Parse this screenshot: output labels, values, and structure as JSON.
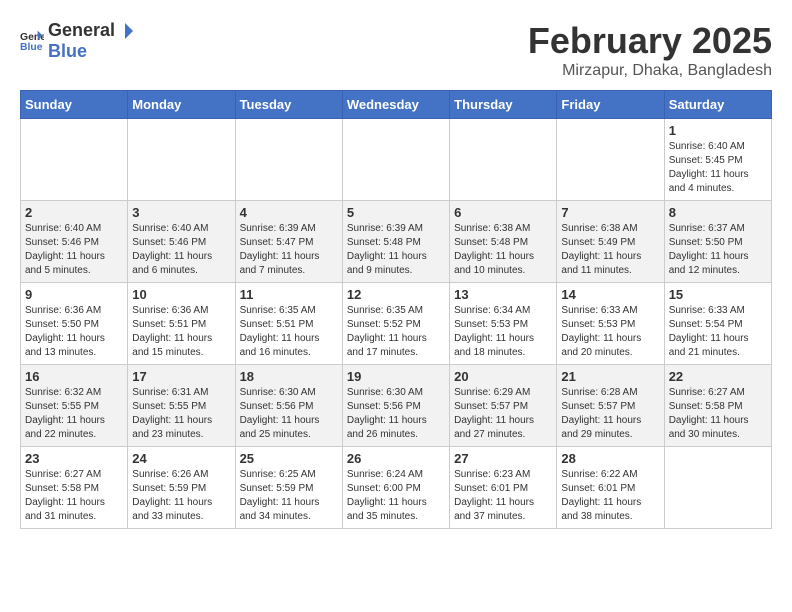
{
  "logo": {
    "general": "General",
    "blue": "Blue"
  },
  "title": "February 2025",
  "subtitle": "Mirzapur, Dhaka, Bangladesh",
  "weekdays": [
    "Sunday",
    "Monday",
    "Tuesday",
    "Wednesday",
    "Thursday",
    "Friday",
    "Saturday"
  ],
  "weeks": [
    [
      {
        "day": "",
        "info": ""
      },
      {
        "day": "",
        "info": ""
      },
      {
        "day": "",
        "info": ""
      },
      {
        "day": "",
        "info": ""
      },
      {
        "day": "",
        "info": ""
      },
      {
        "day": "",
        "info": ""
      },
      {
        "day": "1",
        "info": "Sunrise: 6:40 AM\nSunset: 5:45 PM\nDaylight: 11 hours and 4 minutes."
      }
    ],
    [
      {
        "day": "2",
        "info": "Sunrise: 6:40 AM\nSunset: 5:46 PM\nDaylight: 11 hours and 5 minutes."
      },
      {
        "day": "3",
        "info": "Sunrise: 6:40 AM\nSunset: 5:46 PM\nDaylight: 11 hours and 6 minutes."
      },
      {
        "day": "4",
        "info": "Sunrise: 6:39 AM\nSunset: 5:47 PM\nDaylight: 11 hours and 7 minutes."
      },
      {
        "day": "5",
        "info": "Sunrise: 6:39 AM\nSunset: 5:48 PM\nDaylight: 11 hours and 9 minutes."
      },
      {
        "day": "6",
        "info": "Sunrise: 6:38 AM\nSunset: 5:48 PM\nDaylight: 11 hours and 10 minutes."
      },
      {
        "day": "7",
        "info": "Sunrise: 6:38 AM\nSunset: 5:49 PM\nDaylight: 11 hours and 11 minutes."
      },
      {
        "day": "8",
        "info": "Sunrise: 6:37 AM\nSunset: 5:50 PM\nDaylight: 11 hours and 12 minutes."
      }
    ],
    [
      {
        "day": "9",
        "info": "Sunrise: 6:36 AM\nSunset: 5:50 PM\nDaylight: 11 hours and 13 minutes."
      },
      {
        "day": "10",
        "info": "Sunrise: 6:36 AM\nSunset: 5:51 PM\nDaylight: 11 hours and 15 minutes."
      },
      {
        "day": "11",
        "info": "Sunrise: 6:35 AM\nSunset: 5:51 PM\nDaylight: 11 hours and 16 minutes."
      },
      {
        "day": "12",
        "info": "Sunrise: 6:35 AM\nSunset: 5:52 PM\nDaylight: 11 hours and 17 minutes."
      },
      {
        "day": "13",
        "info": "Sunrise: 6:34 AM\nSunset: 5:53 PM\nDaylight: 11 hours and 18 minutes."
      },
      {
        "day": "14",
        "info": "Sunrise: 6:33 AM\nSunset: 5:53 PM\nDaylight: 11 hours and 20 minutes."
      },
      {
        "day": "15",
        "info": "Sunrise: 6:33 AM\nSunset: 5:54 PM\nDaylight: 11 hours and 21 minutes."
      }
    ],
    [
      {
        "day": "16",
        "info": "Sunrise: 6:32 AM\nSunset: 5:55 PM\nDaylight: 11 hours and 22 minutes."
      },
      {
        "day": "17",
        "info": "Sunrise: 6:31 AM\nSunset: 5:55 PM\nDaylight: 11 hours and 23 minutes."
      },
      {
        "day": "18",
        "info": "Sunrise: 6:30 AM\nSunset: 5:56 PM\nDaylight: 11 hours and 25 minutes."
      },
      {
        "day": "19",
        "info": "Sunrise: 6:30 AM\nSunset: 5:56 PM\nDaylight: 11 hours and 26 minutes."
      },
      {
        "day": "20",
        "info": "Sunrise: 6:29 AM\nSunset: 5:57 PM\nDaylight: 11 hours and 27 minutes."
      },
      {
        "day": "21",
        "info": "Sunrise: 6:28 AM\nSunset: 5:57 PM\nDaylight: 11 hours and 29 minutes."
      },
      {
        "day": "22",
        "info": "Sunrise: 6:27 AM\nSunset: 5:58 PM\nDaylight: 11 hours and 30 minutes."
      }
    ],
    [
      {
        "day": "23",
        "info": "Sunrise: 6:27 AM\nSunset: 5:58 PM\nDaylight: 11 hours and 31 minutes."
      },
      {
        "day": "24",
        "info": "Sunrise: 6:26 AM\nSunset: 5:59 PM\nDaylight: 11 hours and 33 minutes."
      },
      {
        "day": "25",
        "info": "Sunrise: 6:25 AM\nSunset: 5:59 PM\nDaylight: 11 hours and 34 minutes."
      },
      {
        "day": "26",
        "info": "Sunrise: 6:24 AM\nSunset: 6:00 PM\nDaylight: 11 hours and 35 minutes."
      },
      {
        "day": "27",
        "info": "Sunrise: 6:23 AM\nSunset: 6:01 PM\nDaylight: 11 hours and 37 minutes."
      },
      {
        "day": "28",
        "info": "Sunrise: 6:22 AM\nSunset: 6:01 PM\nDaylight: 11 hours and 38 minutes."
      },
      {
        "day": "",
        "info": ""
      }
    ]
  ]
}
